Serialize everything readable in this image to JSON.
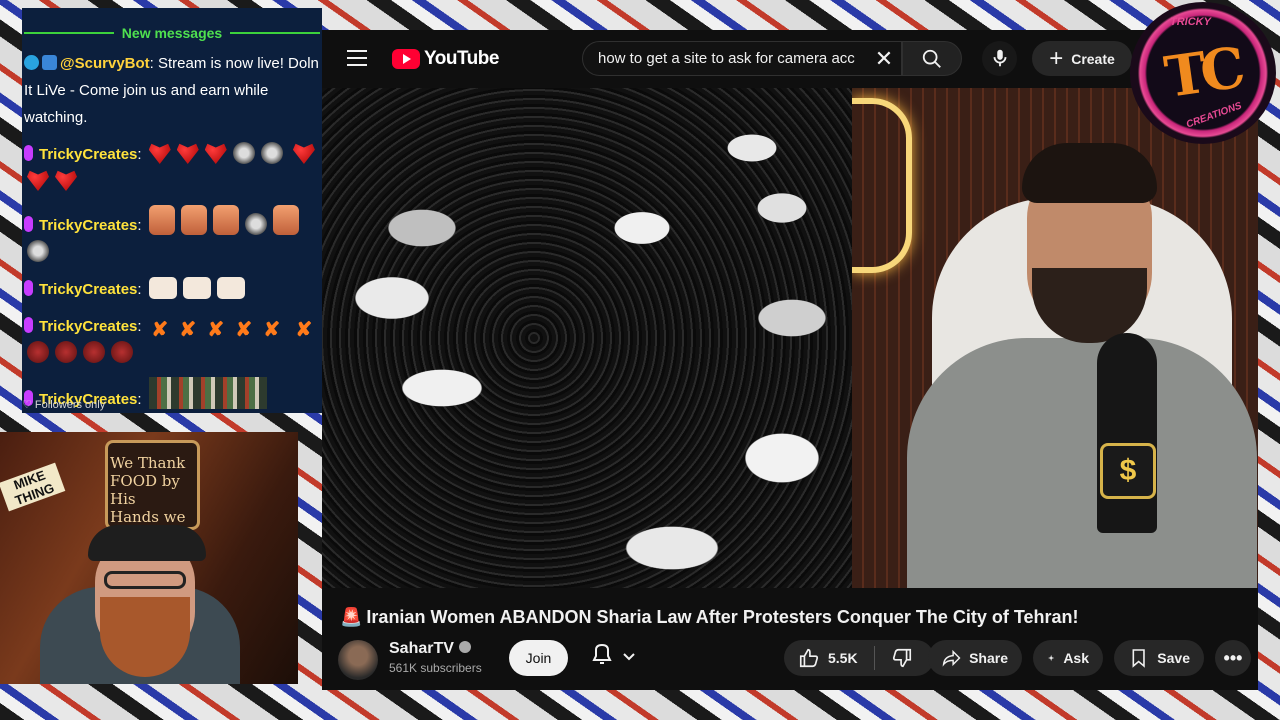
{
  "chat": {
    "divider_label": "New messages",
    "followers_only": "Followers only",
    "messages": [
      {
        "user": "@ScurvyBot",
        "text": ": Stream is now live! Doln It LiVe - Come join us and earn while watching."
      },
      {
        "user": "TrickyCreates",
        "sep": ":"
      },
      {
        "user": "TrickyCreates",
        "sep": ":"
      },
      {
        "user": "TrickyCreates",
        "sep": ":"
      },
      {
        "user": "TrickyCreates",
        "sep": ":"
      },
      {
        "user": "TrickyCreates",
        "sep": ":"
      }
    ]
  },
  "webcam": {
    "sign_text": "We Thank\nFOOD by His\nHands we are FED",
    "hat_text": "MIKE THING"
  },
  "youtube": {
    "logo_text": "YouTube",
    "search_value": "how to get a site to ask for camera acc",
    "create_label": "Create",
    "video_title": "Iranian Women ABANDON Sharia Law After Protesters Conquer The City of Tehran!",
    "channel_name": "SaharTV",
    "subscribers": "561K subscribers",
    "join_label": "Join",
    "like_count": "5.5K",
    "share_label": "Share",
    "ask_label": "Ask",
    "save_label": "Save"
  },
  "streamer_logo": {
    "initials": "TC",
    "top_text": "TRICKY",
    "bottom_text": "CREATIONS"
  },
  "colors": {
    "chat_bg": "#0c1f3d",
    "new_messages_green": "#4fe04f",
    "username_yellow": "#ffe23c",
    "youtube_red": "#ff0033",
    "yt_bg": "#0f0f0f"
  }
}
